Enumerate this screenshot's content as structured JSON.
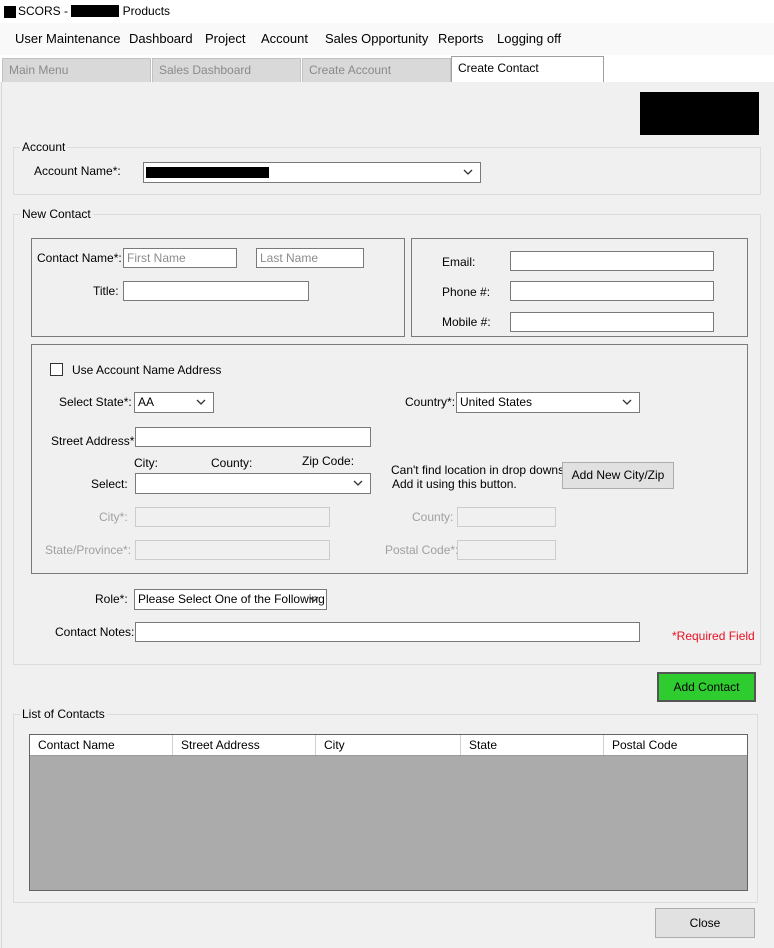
{
  "window": {
    "title_prefix": "SCORS - ",
    "title_suffix": " Products"
  },
  "menu": [
    "User Maintenance",
    "Dashboard",
    "Project",
    "Account",
    "Sales Opportunity",
    "Reports",
    "Logging off"
  ],
  "tabs": [
    {
      "label": "Main Menu",
      "active": false
    },
    {
      "label": "Sales Dashboard",
      "active": false
    },
    {
      "label": "Create Account",
      "active": false
    },
    {
      "label": "Create Contact",
      "active": true
    }
  ],
  "account": {
    "group_label": "Account",
    "name_label": "Account Name*:"
  },
  "new_contact": {
    "group_label": "New Contact",
    "contact_name_label": "Contact Name*:",
    "first_name_placeholder": "First Name",
    "last_name_placeholder": "Last Name",
    "title_label": "Title:",
    "email_label": "Email:",
    "phone_label": "Phone #:",
    "mobile_label": "Mobile #:"
  },
  "address": {
    "use_account_address_label": "Use Account Name Address",
    "select_state_label": "Select State*:",
    "select_state_value": "AA",
    "country_label": "Country*:",
    "country_value": "United States",
    "street_label": "Street Address*:",
    "col_city": "City:",
    "col_county": "County:",
    "col_zip": "Zip Code:",
    "select_label": "Select:",
    "cant_find_line1": "Can't find location in drop downs?",
    "cant_find_line2": "Add it using this button.",
    "add_city_zip_button": "Add New City/Zip",
    "city_label": "City*:",
    "county_label": "County:",
    "state_province_label": "State/Province*:",
    "postal_code_label": "Postal Code*:"
  },
  "role": {
    "label": "Role*:",
    "value": "Please Select One of the Following"
  },
  "notes": {
    "label": "Contact Notes:"
  },
  "required_field_note": "*Required Field",
  "add_contact_button": "Add Contact",
  "contacts_list": {
    "group_label": "List of Contacts",
    "columns": [
      "Contact Name",
      "Street Address",
      "City",
      "State",
      "Postal Code"
    ],
    "rows": []
  },
  "close_button": "Close",
  "colors": {
    "accent_green": "#2ecc2e",
    "required_red": "#e81123",
    "grid_bg": "#ababab"
  }
}
